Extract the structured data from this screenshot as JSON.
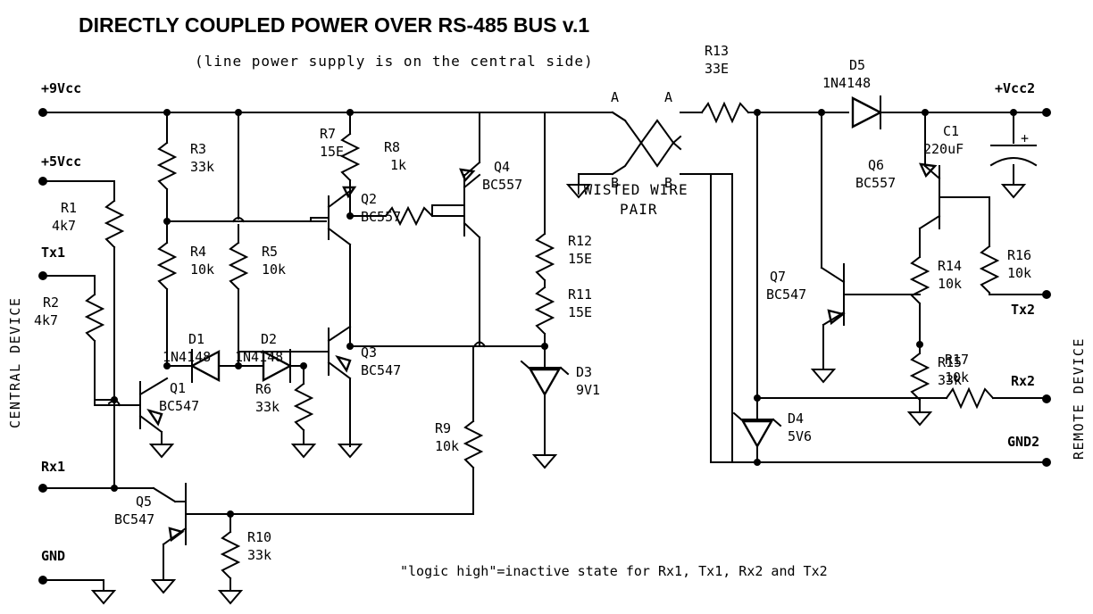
{
  "title": "DIRECTLY COUPLED POWER OVER RS-485 BUS v.1",
  "subtitle": "(line power supply is on the central side)",
  "footnote": "\"logic high\"=inactive state for Rx1, Tx1, Rx2 and Tx2",
  "side_labels": {
    "left": "CENTRAL DEVICE",
    "right": "REMOTE DEVICE"
  },
  "bus": {
    "name": "TWISTED WIRE PAIR",
    "line1": "TWISTED WIRE",
    "line2": "PAIR",
    "conductor_a_left": "A",
    "conductor_a_right": "A",
    "conductor_b_left": "B",
    "conductor_b_right": "B"
  },
  "terminals": {
    "left": [
      {
        "name": "+9Vcc",
        "label": "+9Vcc"
      },
      {
        "name": "+5Vcc",
        "label": "+5Vcc"
      },
      {
        "name": "Tx1",
        "label": "Tx1"
      },
      {
        "name": "Rx1",
        "label": "Rx1"
      },
      {
        "name": "GND",
        "label": "GND"
      }
    ],
    "right": [
      {
        "name": "+Vcc2",
        "label": "+Vcc2"
      },
      {
        "name": "Tx2",
        "label": "Tx2"
      },
      {
        "name": "Rx2",
        "label": "Rx2"
      },
      {
        "name": "GND2",
        "label": "GND2"
      }
    ]
  },
  "components": {
    "resistors": [
      {
        "ref": "R1",
        "value": "4k7"
      },
      {
        "ref": "R2",
        "value": "4k7"
      },
      {
        "ref": "R3",
        "value": "33k"
      },
      {
        "ref": "R4",
        "value": "10k"
      },
      {
        "ref": "R5",
        "value": "10k"
      },
      {
        "ref": "R6",
        "value": "33k"
      },
      {
        "ref": "R7",
        "value": "15E"
      },
      {
        "ref": "R8",
        "value": "1k"
      },
      {
        "ref": "R9",
        "value": "10k"
      },
      {
        "ref": "R10",
        "value": "33k"
      },
      {
        "ref": "R11",
        "value": "15E"
      },
      {
        "ref": "R12",
        "value": "15E"
      },
      {
        "ref": "R13",
        "value": "33E"
      },
      {
        "ref": "R14",
        "value": "10k"
      },
      {
        "ref": "R15",
        "value": "33k"
      },
      {
        "ref": "R16",
        "value": "10k"
      },
      {
        "ref": "R17",
        "value": "10k"
      }
    ],
    "diodes": [
      {
        "ref": "D1",
        "value": "1N4148"
      },
      {
        "ref": "D2",
        "value": "1N4148"
      },
      {
        "ref": "D3",
        "value": "9V1"
      },
      {
        "ref": "D4",
        "value": "5V6"
      },
      {
        "ref": "D5",
        "value": "1N4148"
      }
    ],
    "transistors": [
      {
        "ref": "Q1",
        "value": "BC547"
      },
      {
        "ref": "Q2",
        "value": "BC557"
      },
      {
        "ref": "Q3",
        "value": "BC547"
      },
      {
        "ref": "Q4",
        "value": "BC557"
      },
      {
        "ref": "Q5",
        "value": "BC547"
      },
      {
        "ref": "Q6",
        "value": "BC557"
      },
      {
        "ref": "Q7",
        "value": "BC547"
      }
    ],
    "capacitors": [
      {
        "ref": "C1",
        "value": "220uF",
        "polarity": "+"
      }
    ]
  },
  "colors": {
    "background": "#ffffff",
    "ink": "#000000"
  }
}
